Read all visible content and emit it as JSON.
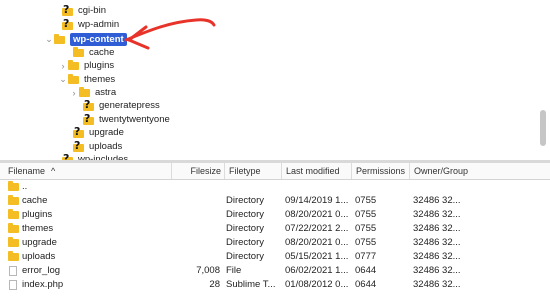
{
  "tree": {
    "items": [
      {
        "label": "cgi-bin",
        "icon": "unknown-folder-icon",
        "chevron": ""
      },
      {
        "label": "wp-admin",
        "icon": "unknown-folder-icon",
        "chevron": ""
      },
      {
        "label": "wp-content",
        "icon": "folder-icon",
        "chevron": "expanded",
        "selected": true
      },
      {
        "label": "cache",
        "icon": "folder-icon",
        "chevron": ""
      },
      {
        "label": "plugins",
        "icon": "folder-icon",
        "chevron": "collapsed"
      },
      {
        "label": "themes",
        "icon": "folder-icon",
        "chevron": "expanded"
      },
      {
        "label": "astra",
        "icon": "folder-icon",
        "chevron": "collapsed"
      },
      {
        "label": "generatepress",
        "icon": "unknown-folder-icon",
        "chevron": ""
      },
      {
        "label": "twentytwentyone",
        "icon": "unknown-folder-icon",
        "chevron": ""
      },
      {
        "label": "upgrade",
        "icon": "unknown-folder-icon",
        "chevron": ""
      },
      {
        "label": "uploads",
        "icon": "unknown-folder-icon",
        "chevron": ""
      },
      {
        "label": "wp-includes",
        "icon": "unknown-folder-icon",
        "chevron": ""
      }
    ]
  },
  "list": {
    "columns": {
      "filename": "Filename",
      "filesize": "Filesize",
      "filetype": "Filetype",
      "last_modified": "Last modified",
      "permissions": "Permissions",
      "owner_group": "Owner/Group"
    },
    "rows": [
      {
        "name": "..",
        "size": "",
        "type": "",
        "modified": "",
        "perms": "",
        "owner": "",
        "icon": "folder-icon"
      },
      {
        "name": "cache",
        "size": "",
        "type": "Directory",
        "modified": "09/14/2019 1...",
        "perms": "0755",
        "owner": "32486 32...",
        "icon": "folder-icon"
      },
      {
        "name": "plugins",
        "size": "",
        "type": "Directory",
        "modified": "08/20/2021 0...",
        "perms": "0755",
        "owner": "32486 32...",
        "icon": "folder-icon"
      },
      {
        "name": "themes",
        "size": "",
        "type": "Directory",
        "modified": "07/22/2021 2...",
        "perms": "0755",
        "owner": "32486 32...",
        "icon": "folder-icon"
      },
      {
        "name": "upgrade",
        "size": "",
        "type": "Directory",
        "modified": "08/20/2021 0...",
        "perms": "0755",
        "owner": "32486 32...",
        "icon": "folder-icon"
      },
      {
        "name": "uploads",
        "size": "",
        "type": "Directory",
        "modified": "05/15/2021 1...",
        "perms": "0777",
        "owner": "32486 32...",
        "icon": "folder-icon"
      },
      {
        "name": "error_log",
        "size": "7,008",
        "type": "File",
        "modified": "06/02/2021 1...",
        "perms": "0644",
        "owner": "32486 32...",
        "icon": "file-icon"
      },
      {
        "name": "index.php",
        "size": "28",
        "type": "Sublime T...",
        "modified": "01/08/2012 0...",
        "perms": "0644",
        "owner": "32486 32...",
        "icon": "file-icon"
      }
    ]
  },
  "colors": {
    "folder": "#f4bd24",
    "selection": "#2f5dd6",
    "arrow": "#e8332a"
  }
}
